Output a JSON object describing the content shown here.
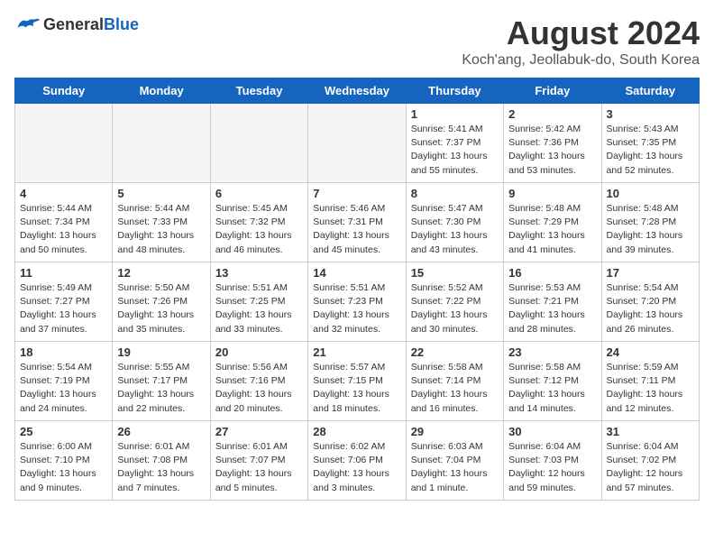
{
  "header": {
    "logo_general": "General",
    "logo_blue": "Blue",
    "title": "August 2024",
    "subtitle": "Koch'ang, Jeollabuk-do, South Korea"
  },
  "days_of_week": [
    "Sunday",
    "Monday",
    "Tuesday",
    "Wednesday",
    "Thursday",
    "Friday",
    "Saturday"
  ],
  "weeks": [
    [
      {
        "day": "",
        "empty": true
      },
      {
        "day": "",
        "empty": true
      },
      {
        "day": "",
        "empty": true
      },
      {
        "day": "",
        "empty": true
      },
      {
        "day": "1",
        "sunrise": "5:41 AM",
        "sunset": "7:37 PM",
        "daylight": "13 hours and 55 minutes."
      },
      {
        "day": "2",
        "sunrise": "5:42 AM",
        "sunset": "7:36 PM",
        "daylight": "13 hours and 53 minutes."
      },
      {
        "day": "3",
        "sunrise": "5:43 AM",
        "sunset": "7:35 PM",
        "daylight": "13 hours and 52 minutes."
      }
    ],
    [
      {
        "day": "4",
        "sunrise": "5:44 AM",
        "sunset": "7:34 PM",
        "daylight": "13 hours and 50 minutes."
      },
      {
        "day": "5",
        "sunrise": "5:44 AM",
        "sunset": "7:33 PM",
        "daylight": "13 hours and 48 minutes."
      },
      {
        "day": "6",
        "sunrise": "5:45 AM",
        "sunset": "7:32 PM",
        "daylight": "13 hours and 46 minutes."
      },
      {
        "day": "7",
        "sunrise": "5:46 AM",
        "sunset": "7:31 PM",
        "daylight": "13 hours and 45 minutes."
      },
      {
        "day": "8",
        "sunrise": "5:47 AM",
        "sunset": "7:30 PM",
        "daylight": "13 hours and 43 minutes."
      },
      {
        "day": "9",
        "sunrise": "5:48 AM",
        "sunset": "7:29 PM",
        "daylight": "13 hours and 41 minutes."
      },
      {
        "day": "10",
        "sunrise": "5:48 AM",
        "sunset": "7:28 PM",
        "daylight": "13 hours and 39 minutes."
      }
    ],
    [
      {
        "day": "11",
        "sunrise": "5:49 AM",
        "sunset": "7:27 PM",
        "daylight": "13 hours and 37 minutes."
      },
      {
        "day": "12",
        "sunrise": "5:50 AM",
        "sunset": "7:26 PM",
        "daylight": "13 hours and 35 minutes."
      },
      {
        "day": "13",
        "sunrise": "5:51 AM",
        "sunset": "7:25 PM",
        "daylight": "13 hours and 33 minutes."
      },
      {
        "day": "14",
        "sunrise": "5:51 AM",
        "sunset": "7:23 PM",
        "daylight": "13 hours and 32 minutes."
      },
      {
        "day": "15",
        "sunrise": "5:52 AM",
        "sunset": "7:22 PM",
        "daylight": "13 hours and 30 minutes."
      },
      {
        "day": "16",
        "sunrise": "5:53 AM",
        "sunset": "7:21 PM",
        "daylight": "13 hours and 28 minutes."
      },
      {
        "day": "17",
        "sunrise": "5:54 AM",
        "sunset": "7:20 PM",
        "daylight": "13 hours and 26 minutes."
      }
    ],
    [
      {
        "day": "18",
        "sunrise": "5:54 AM",
        "sunset": "7:19 PM",
        "daylight": "13 hours and 24 minutes."
      },
      {
        "day": "19",
        "sunrise": "5:55 AM",
        "sunset": "7:17 PM",
        "daylight": "13 hours and 22 minutes."
      },
      {
        "day": "20",
        "sunrise": "5:56 AM",
        "sunset": "7:16 PM",
        "daylight": "13 hours and 20 minutes."
      },
      {
        "day": "21",
        "sunrise": "5:57 AM",
        "sunset": "7:15 PM",
        "daylight": "13 hours and 18 minutes."
      },
      {
        "day": "22",
        "sunrise": "5:58 AM",
        "sunset": "7:14 PM",
        "daylight": "13 hours and 16 minutes."
      },
      {
        "day": "23",
        "sunrise": "5:58 AM",
        "sunset": "7:12 PM",
        "daylight": "13 hours and 14 minutes."
      },
      {
        "day": "24",
        "sunrise": "5:59 AM",
        "sunset": "7:11 PM",
        "daylight": "13 hours and 12 minutes."
      }
    ],
    [
      {
        "day": "25",
        "sunrise": "6:00 AM",
        "sunset": "7:10 PM",
        "daylight": "13 hours and 9 minutes."
      },
      {
        "day": "26",
        "sunrise": "6:01 AM",
        "sunset": "7:08 PM",
        "daylight": "13 hours and 7 minutes."
      },
      {
        "day": "27",
        "sunrise": "6:01 AM",
        "sunset": "7:07 PM",
        "daylight": "13 hours and 5 minutes."
      },
      {
        "day": "28",
        "sunrise": "6:02 AM",
        "sunset": "7:06 PM",
        "daylight": "13 hours and 3 minutes."
      },
      {
        "day": "29",
        "sunrise": "6:03 AM",
        "sunset": "7:04 PM",
        "daylight": "13 hours and 1 minute."
      },
      {
        "day": "30",
        "sunrise": "6:04 AM",
        "sunset": "7:03 PM",
        "daylight": "12 hours and 59 minutes."
      },
      {
        "day": "31",
        "sunrise": "6:04 AM",
        "sunset": "7:02 PM",
        "daylight": "12 hours and 57 minutes."
      }
    ]
  ],
  "labels": {
    "sunrise": "Sunrise:",
    "sunset": "Sunset:",
    "daylight": "Daylight:"
  }
}
